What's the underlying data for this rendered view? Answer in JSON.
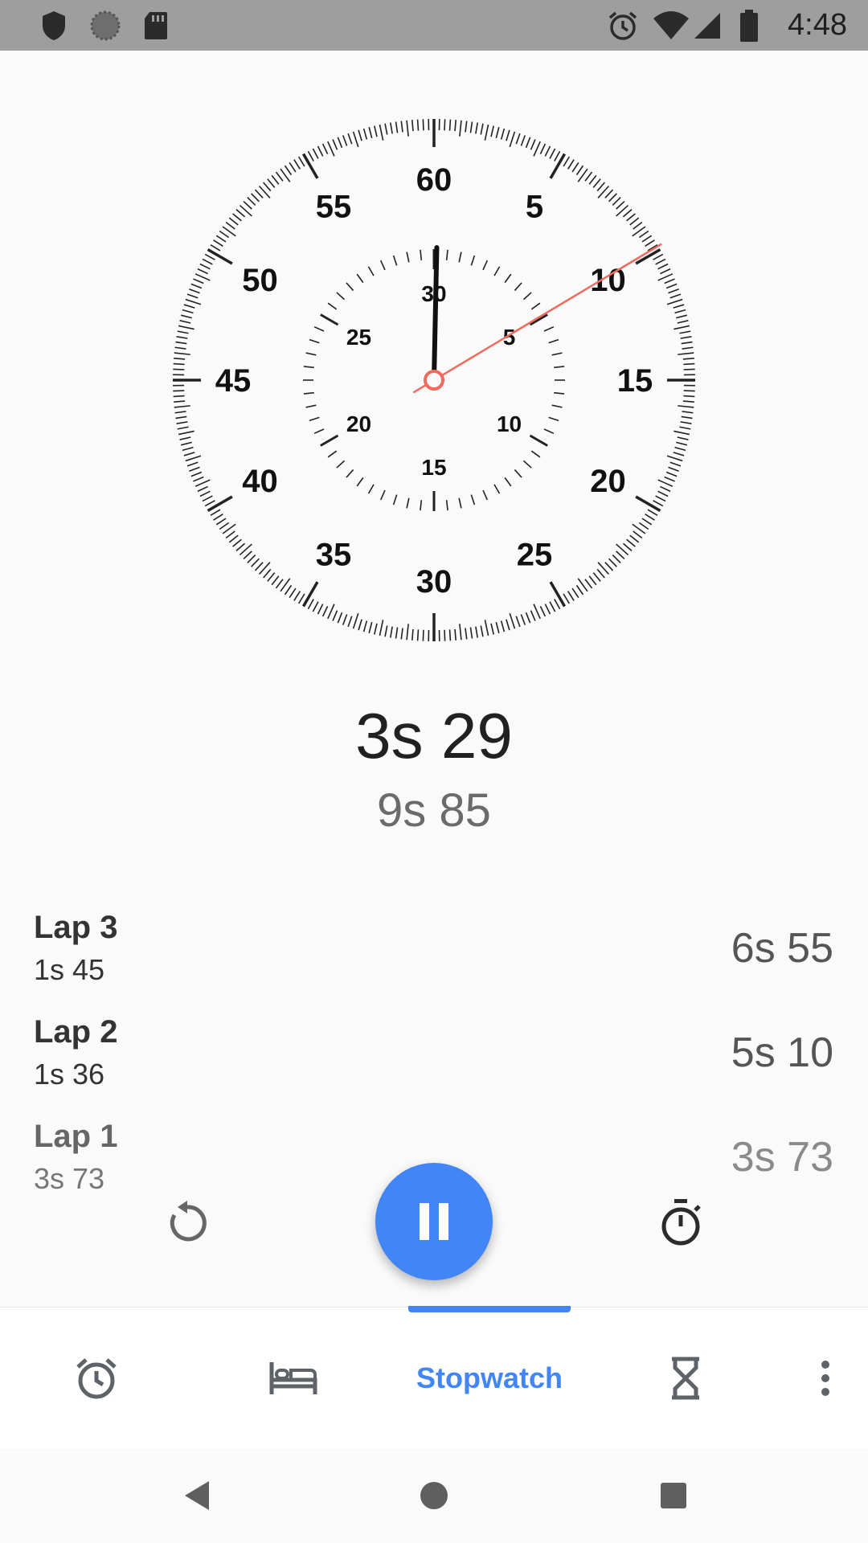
{
  "status_bar": {
    "time": "4:48",
    "left_icons": [
      "shield-icon",
      "sync-icon",
      "sd-card-icon"
    ],
    "right_icons": [
      "alarm-icon",
      "wifi-icon",
      "cell-signal-icon",
      "battery-icon"
    ]
  },
  "dial": {
    "outer_labels": [
      "60",
      "5",
      "10",
      "15",
      "20",
      "25",
      "30",
      "35",
      "40",
      "45",
      "50",
      "55"
    ],
    "inner_labels": [
      "30",
      "5",
      "10",
      "15",
      "20",
      "25"
    ],
    "second_hand_seconds": 9.85,
    "inner_hand_seconds": 0.2,
    "hand_color": "#f06a5e"
  },
  "timer": {
    "current_lap_time": "3s 29",
    "total_time": "9s 85"
  },
  "laps": [
    {
      "name": "Lap 3",
      "split": "1s 45",
      "cumulative": "6s 55"
    },
    {
      "name": "Lap 2",
      "split": "1s 36",
      "cumulative": "5s 10"
    },
    {
      "name": "Lap 1",
      "split": "3s 73",
      "cumulative": "3s 73"
    }
  ],
  "controls": {
    "reset_icon": "reset-icon",
    "pause_icon": "pause-icon",
    "lap_icon": "stopwatch-icon",
    "accent": "#4285f4"
  },
  "bottom_nav": {
    "active_label": "Stopwatch",
    "items": [
      "alarm-icon",
      "bedtime-icon",
      "stopwatch-tab",
      "timer-icon",
      "more-icon"
    ]
  },
  "system_nav": [
    "back-icon",
    "home-icon",
    "recents-icon"
  ]
}
